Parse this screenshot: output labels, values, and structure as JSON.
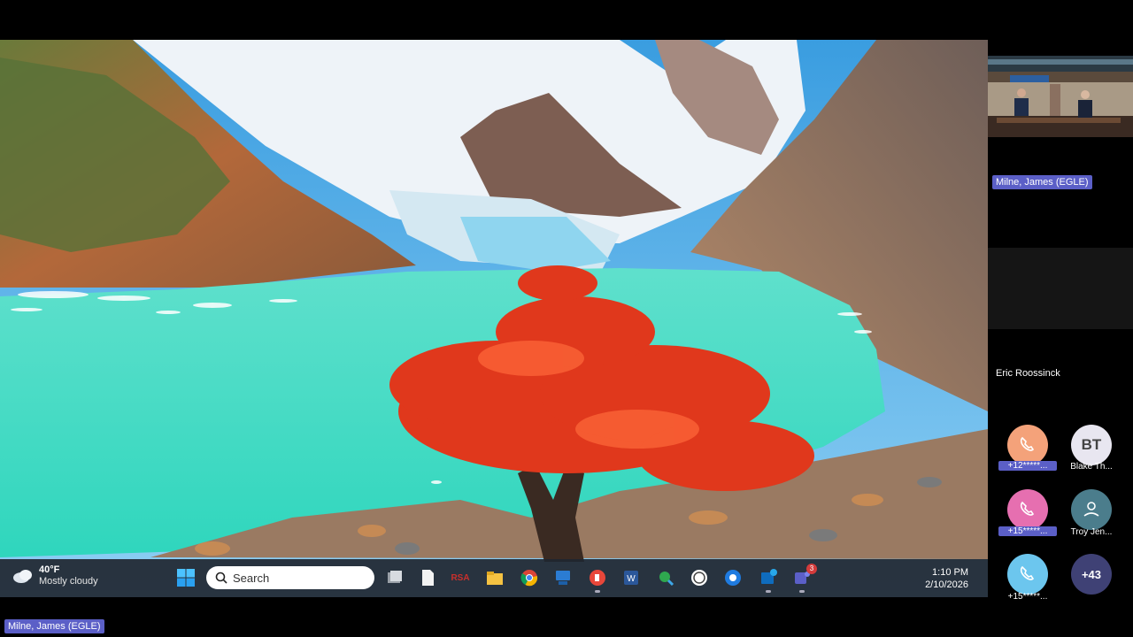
{
  "meeting": {
    "presenter_name": "Milne, James (EGLE)"
  },
  "taskbar": {
    "weather_temp": "40°F",
    "weather_condition": "Mostly cloudy",
    "search_placeholder": "Search",
    "clock_time": "1:10 PM",
    "clock_date": "2/10/2026",
    "notification_badge": "3",
    "pinned_icons": [
      "task-view-icon",
      "notepad-icon",
      "rsa-icon",
      "file-explorer-icon",
      "chrome-icon",
      "remote-desktop-icon",
      "pdf-icon",
      "word-icon",
      "magnifier-icon",
      "clock-app-icon",
      "edge-icon",
      "outlook-icon",
      "teams-icon"
    ],
    "rsa_label": "RSA"
  },
  "panel": {
    "video_tile_label": "Milne, James (EGLE)",
    "audio_tile_label": "Eric Roossinck",
    "participants": [
      {
        "label": "+12*****...",
        "type": "phone",
        "color": "#f4a27a"
      },
      {
        "label": "Blake Th...",
        "initials": "BT",
        "color": "#e8e6f0"
      },
      {
        "label": "+15*****...",
        "type": "phone",
        "color": "#e66fb0"
      },
      {
        "label": "Troy Jen...",
        "type": "person",
        "color": "#4b7d8c"
      },
      {
        "label": "+15*****...",
        "type": "phone",
        "color": "#6cc6ee"
      },
      {
        "more": "+43",
        "color": "#3f4175"
      }
    ]
  },
  "colors": {
    "teams_purple": "#5b5fc7",
    "lake": "#3fd9c2",
    "tree": "#e0381c"
  }
}
